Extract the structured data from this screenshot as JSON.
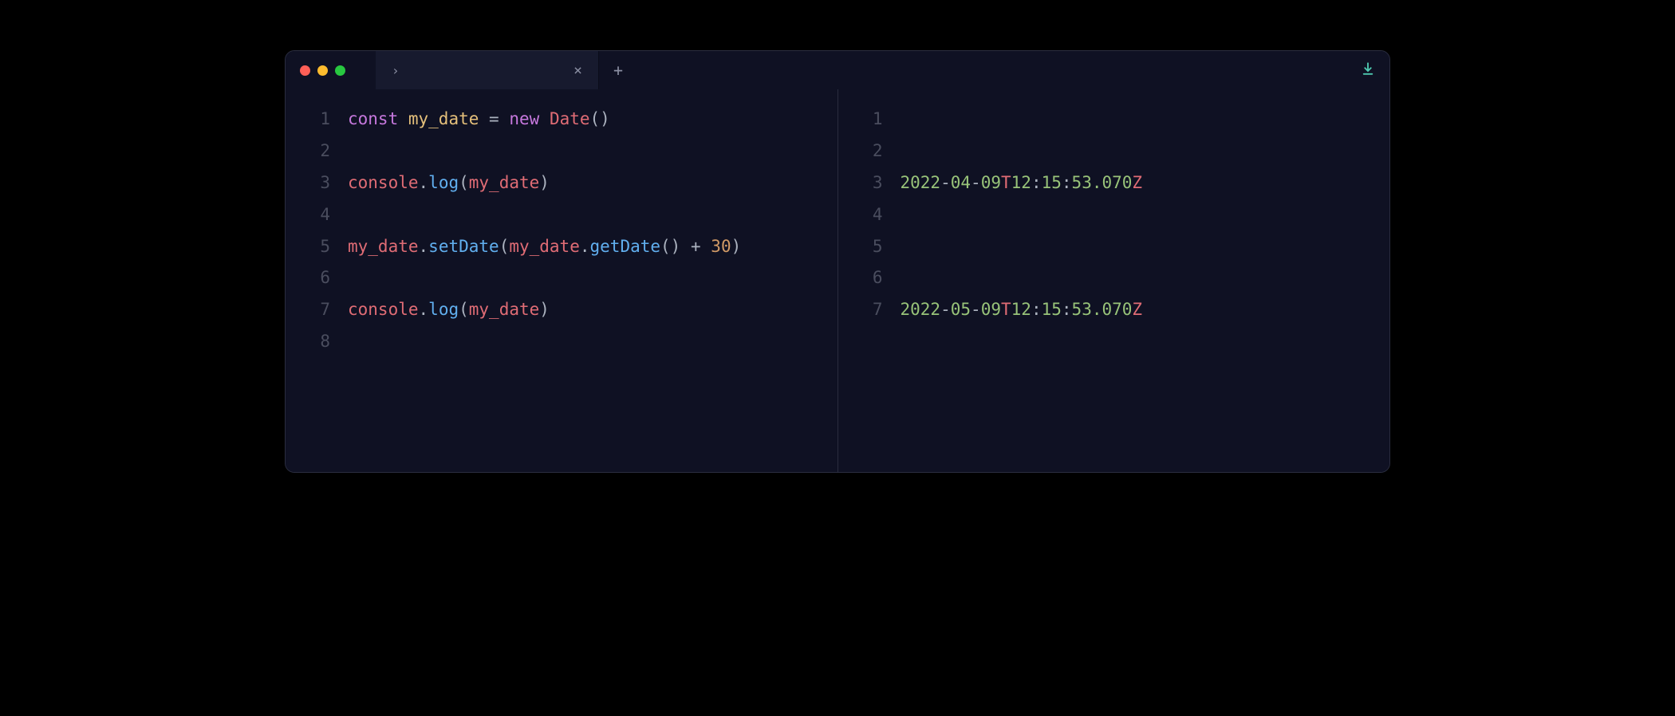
{
  "tab": {
    "title": "›",
    "close": "×",
    "new": "+"
  },
  "left_pane": {
    "lines": [
      {
        "num": "1",
        "tokens": [
          {
            "t": "const",
            "c": "tok-keyword"
          },
          {
            "t": " ",
            "c": "tok-plain"
          },
          {
            "t": "my_date",
            "c": "tok-variable2"
          },
          {
            "t": " ",
            "c": "tok-plain"
          },
          {
            "t": "=",
            "c": "tok-punct"
          },
          {
            "t": " ",
            "c": "tok-plain"
          },
          {
            "t": "new",
            "c": "tok-keyword"
          },
          {
            "t": " ",
            "c": "tok-plain"
          },
          {
            "t": "Date",
            "c": "tok-variable"
          },
          {
            "t": "()",
            "c": "tok-punct"
          }
        ]
      },
      {
        "num": "2",
        "tokens": []
      },
      {
        "num": "3",
        "tokens": [
          {
            "t": "console",
            "c": "tok-variable"
          },
          {
            "t": ".",
            "c": "tok-punct"
          },
          {
            "t": "log",
            "c": "tok-method"
          },
          {
            "t": "(",
            "c": "tok-punct"
          },
          {
            "t": "my_date",
            "c": "tok-variable"
          },
          {
            "t": ")",
            "c": "tok-punct"
          }
        ]
      },
      {
        "num": "4",
        "tokens": []
      },
      {
        "num": "5",
        "tokens": [
          {
            "t": "my_date",
            "c": "tok-variable"
          },
          {
            "t": ".",
            "c": "tok-punct"
          },
          {
            "t": "setDate",
            "c": "tok-method"
          },
          {
            "t": "(",
            "c": "tok-punct"
          },
          {
            "t": "my_date",
            "c": "tok-variable"
          },
          {
            "t": ".",
            "c": "tok-punct"
          },
          {
            "t": "getDate",
            "c": "tok-method"
          },
          {
            "t": "()",
            "c": "tok-punct"
          },
          {
            "t": " ",
            "c": "tok-plain"
          },
          {
            "t": "+",
            "c": "tok-punct"
          },
          {
            "t": " ",
            "c": "tok-plain"
          },
          {
            "t": "30",
            "c": "tok-number"
          },
          {
            "t": ")",
            "c": "tok-punct"
          }
        ]
      },
      {
        "num": "6",
        "tokens": []
      },
      {
        "num": "7",
        "tokens": [
          {
            "t": "console",
            "c": "tok-variable"
          },
          {
            "t": ".",
            "c": "tok-punct"
          },
          {
            "t": "log",
            "c": "tok-method"
          },
          {
            "t": "(",
            "c": "tok-punct"
          },
          {
            "t": "my_date",
            "c": "tok-variable"
          },
          {
            "t": ")",
            "c": "tok-punct"
          }
        ]
      },
      {
        "num": "8",
        "tokens": []
      }
    ]
  },
  "right_pane": {
    "lines": [
      {
        "num": "1",
        "tokens": []
      },
      {
        "num": "2",
        "tokens": []
      },
      {
        "num": "3",
        "tokens": [
          {
            "t": "2022",
            "c": "tok-date"
          },
          {
            "t": "-",
            "c": "tok-punct"
          },
          {
            "t": "04",
            "c": "tok-date"
          },
          {
            "t": "-",
            "c": "tok-punct"
          },
          {
            "t": "09",
            "c": "tok-date"
          },
          {
            "t": "T",
            "c": "tok-datet"
          },
          {
            "t": "12",
            "c": "tok-date"
          },
          {
            "t": ":",
            "c": "tok-colon"
          },
          {
            "t": "15",
            "c": "tok-date"
          },
          {
            "t": ":",
            "c": "tok-colon"
          },
          {
            "t": "53.070",
            "c": "tok-date"
          },
          {
            "t": "Z",
            "c": "tok-datez"
          }
        ]
      },
      {
        "num": "4",
        "tokens": []
      },
      {
        "num": "5",
        "tokens": []
      },
      {
        "num": "6",
        "tokens": []
      },
      {
        "num": "7",
        "tokens": [
          {
            "t": "2022",
            "c": "tok-date"
          },
          {
            "t": "-",
            "c": "tok-punct"
          },
          {
            "t": "05",
            "c": "tok-date"
          },
          {
            "t": "-",
            "c": "tok-punct"
          },
          {
            "t": "09",
            "c": "tok-date"
          },
          {
            "t": "T",
            "c": "tok-datet"
          },
          {
            "t": "12",
            "c": "tok-date"
          },
          {
            "t": ":",
            "c": "tok-colon"
          },
          {
            "t": "15",
            "c": "tok-date"
          },
          {
            "t": ":",
            "c": "tok-colon"
          },
          {
            "t": "53.070",
            "c": "tok-date"
          },
          {
            "t": "Z",
            "c": "tok-datez"
          }
        ]
      }
    ]
  }
}
